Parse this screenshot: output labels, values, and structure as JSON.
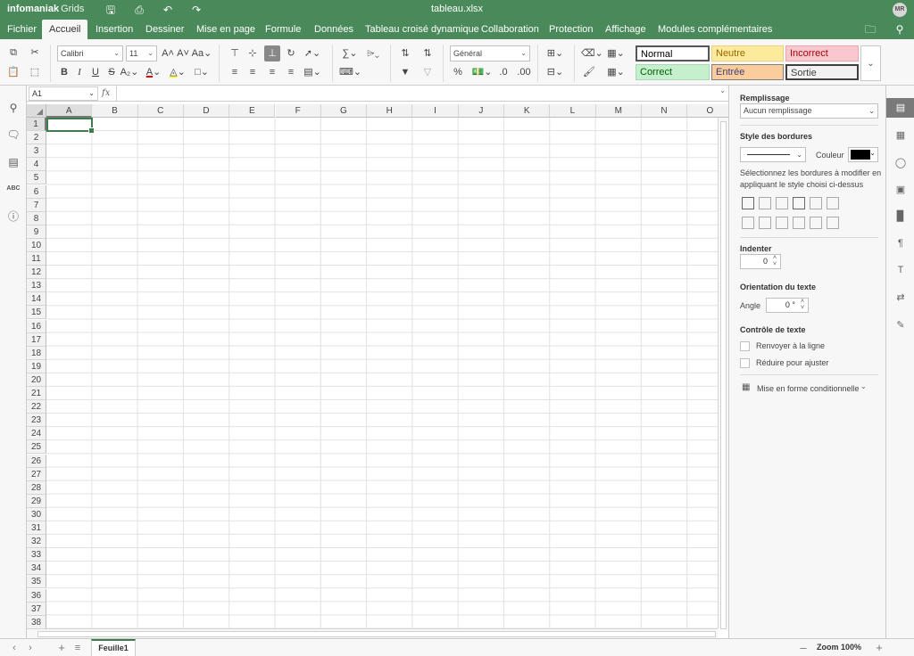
{
  "app": {
    "brand": "infomaniak",
    "brand_sub": "Grids",
    "document_title": "tableau.xlsx",
    "user_initials": "MR"
  },
  "tabs": [
    {
      "label": "Fichier"
    },
    {
      "label": "Accueil",
      "active": true
    },
    {
      "label": "Insertion"
    },
    {
      "label": "Dessiner"
    },
    {
      "label": "Mise en page"
    },
    {
      "label": "Formule"
    },
    {
      "label": "Données"
    },
    {
      "label": "Tableau croisé dynamique"
    },
    {
      "label": "Collaboration"
    },
    {
      "label": "Protection"
    },
    {
      "label": "Affichage"
    },
    {
      "label": "Modules complémentaires"
    }
  ],
  "toolbar": {
    "font_name": "Calibri",
    "font_size": "11",
    "number_format": "Général",
    "cell_styles": [
      {
        "label": "Normal",
        "bg": "#ffffff",
        "fg": "#000000",
        "border": "#555555"
      },
      {
        "label": "Neutre",
        "bg": "#fdeb9c",
        "fg": "#9c6500",
        "border": "#e8d27c"
      },
      {
        "label": "Incorrect",
        "bg": "#fbc7ce",
        "fg": "#9c0006",
        "border": "#e9a7b0"
      },
      {
        "label": "Correct",
        "bg": "#c6efce",
        "fg": "#006100",
        "border": "#a9d8b2"
      },
      {
        "label": "Entrée",
        "bg": "#fbcc9c",
        "fg": "#3f3f76",
        "border": "#7f7f7f"
      },
      {
        "label": "Sortie",
        "bg": "#f2f2f2",
        "fg": "#3f3f3f",
        "border": "#3f3f3f"
      }
    ]
  },
  "formula_bar": {
    "cell_ref": "A1",
    "fx": "fx",
    "value": ""
  },
  "grid": {
    "columns": [
      "A",
      "B",
      "C",
      "D",
      "E",
      "F",
      "G",
      "H",
      "I",
      "J",
      "K",
      "L",
      "M",
      "N",
      "O"
    ],
    "rows": [
      "1",
      "2",
      "3",
      "4",
      "5",
      "6",
      "7",
      "8",
      "9",
      "10",
      "11",
      "12",
      "13",
      "14",
      "15",
      "16",
      "17",
      "18",
      "19",
      "20",
      "21",
      "22",
      "23",
      "24",
      "25",
      "26",
      "27",
      "28",
      "29",
      "30",
      "31",
      "32",
      "33",
      "34",
      "35",
      "36",
      "37",
      "38"
    ],
    "selected_cell": "A1"
  },
  "right_panel": {
    "fill_title": "Remplissage",
    "fill_value": "Aucun remplissage",
    "border_style_title": "Style des bordures",
    "color_label": "Couleur",
    "border_help": "Sélectionnez les bordures à modifier en appliquant le style choisi ci-dessus",
    "indent_title": "Indenter",
    "indent_value": "0",
    "orientation_title": "Orientation du texte",
    "angle_label": "Angle",
    "angle_value": "0 °",
    "text_control_title": "Contrôle de texte",
    "wrap_label": "Renvoyer à la ligne",
    "shrink_label": "Réduire pour ajuster",
    "conditional_label": "Mise en forme conditionnelle"
  },
  "status": {
    "sheet_name": "Feuille1",
    "zoom_label": "Zoom 100%"
  }
}
